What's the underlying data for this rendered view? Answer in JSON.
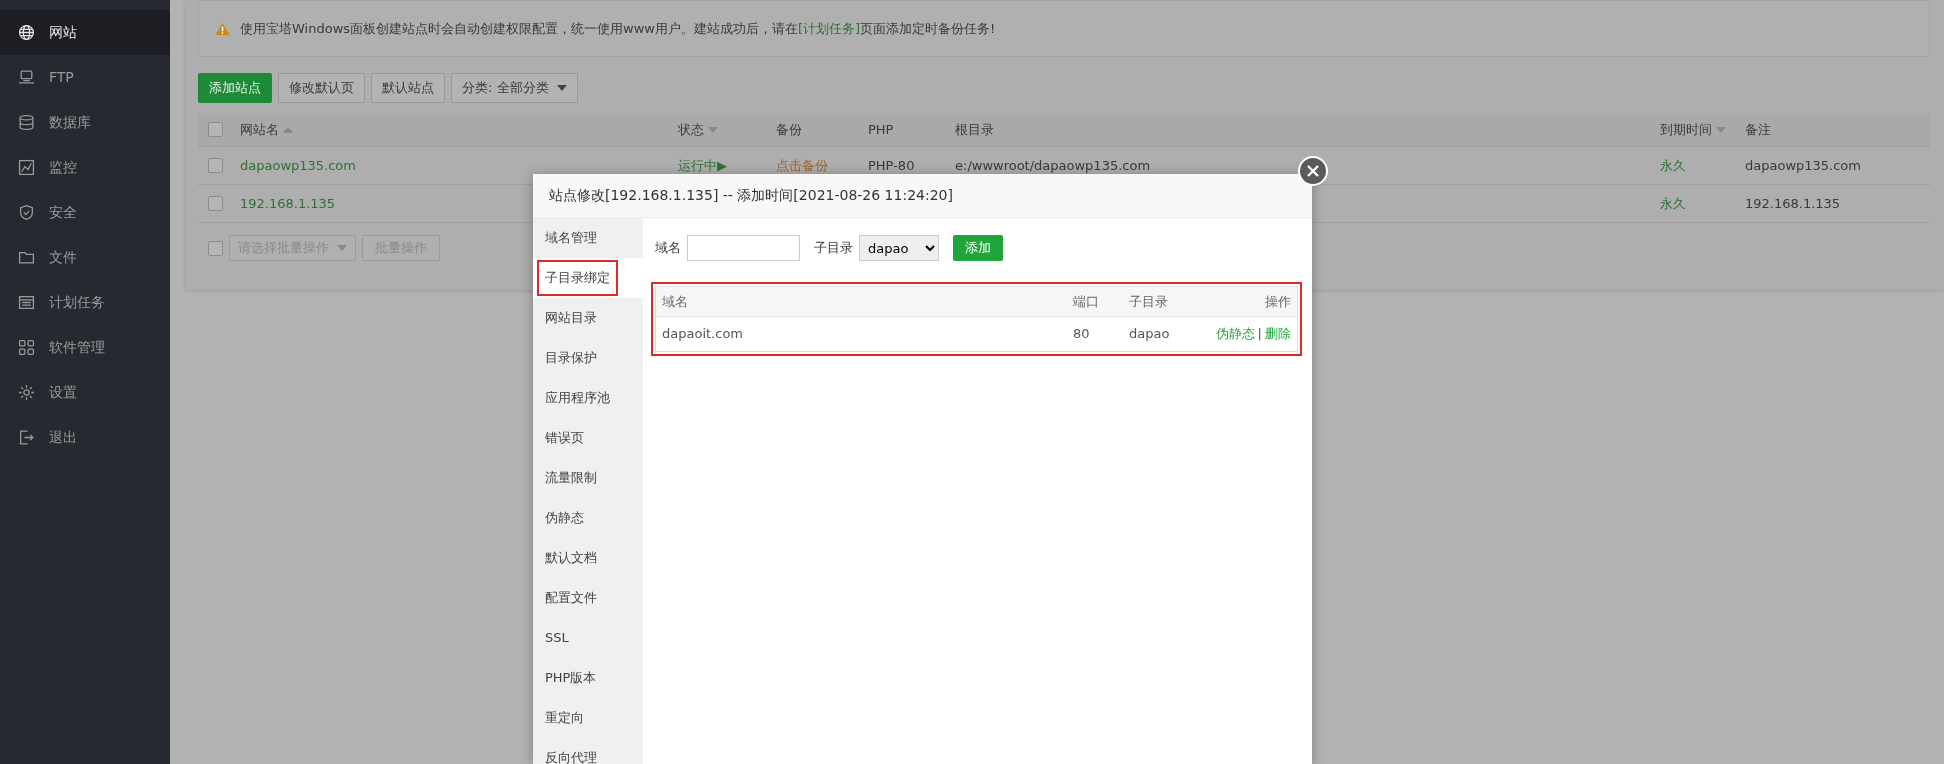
{
  "sidebar": {
    "items": [
      {
        "label": "网站",
        "selected": true
      },
      {
        "label": "FTP",
        "selected": false
      },
      {
        "label": "数据库",
        "selected": false
      },
      {
        "label": "监控",
        "selected": false
      },
      {
        "label": "安全",
        "selected": false
      },
      {
        "label": "文件",
        "selected": false
      },
      {
        "label": "计划任务",
        "selected": false
      },
      {
        "label": "软件管理",
        "selected": false
      },
      {
        "label": "设置",
        "selected": false
      },
      {
        "label": "退出",
        "selected": false
      }
    ]
  },
  "notice": {
    "before": "使用宝塔Windows面板创建站点时会自动创建权限配置，统一使用www用户。建站成功后，请在",
    "link": "[计划任务]",
    "after": "页面添加定时备份任务!"
  },
  "toolbar": [
    {
      "label": "添加站点",
      "kind": "primary"
    },
    {
      "label": "修改默认页",
      "kind": "default"
    },
    {
      "label": "默认站点",
      "kind": "default"
    },
    {
      "label": "分类: 全部分类",
      "kind": "dropdown"
    }
  ],
  "sites_table": {
    "all_checked": false,
    "columns": [
      {
        "label": "网站名",
        "sort_up": true,
        "sort_down": false
      },
      {
        "label": "状态",
        "sort_up": false,
        "sort_down": true
      },
      {
        "label": "备份",
        "sort_up": false,
        "sort_down": false
      },
      {
        "label": "PHP",
        "sort_up": false,
        "sort_down": false
      },
      {
        "label": "根目录",
        "sort_up": false,
        "sort_down": false
      },
      {
        "label": "到期时间",
        "sort_up": false,
        "sort_down": true
      },
      {
        "label": "备注",
        "sort_up": false,
        "sort_down": false
      }
    ],
    "rows": [
      {
        "checked": false,
        "name": "dapaowp135.com",
        "status": "运行中▶",
        "backup": "点击备份",
        "php": "PHP-80",
        "root": "e:/wwwroot/dapaowp135.com",
        "expiry": "永久",
        "note": "dapaowp135.com"
      },
      {
        "checked": false,
        "name": "192.168.1.135",
        "expiry": "永久",
        "note": "192.168.1.135"
      }
    ]
  },
  "batch": {
    "checked": false,
    "select_placeholder": "请选择批量操作",
    "button": "批量操作",
    "disabled": true
  },
  "modal": {
    "title": "站点修改[192.168.1.135] -- 添加时间[2021-08-26 11:24:20]",
    "menu": [
      {
        "label": "域名管理",
        "selected": false,
        "highlighted": false
      },
      {
        "label": "子目录绑定",
        "selected": true,
        "highlighted": true
      },
      {
        "label": "网站目录",
        "selected": false,
        "highlighted": false
      },
      {
        "label": "目录保护",
        "selected": false,
        "highlighted": false
      },
      {
        "label": "应用程序池",
        "selected": false,
        "highlighted": false
      },
      {
        "label": "错误页",
        "selected": false,
        "highlighted": false
      },
      {
        "label": "流量限制",
        "selected": false,
        "highlighted": false
      },
      {
        "label": "伪静态",
        "selected": false,
        "highlighted": false
      },
      {
        "label": "默认文档",
        "selected": false,
        "highlighted": false
      },
      {
        "label": "配置文件",
        "selected": false,
        "highlighted": false
      },
      {
        "label": "SSL",
        "selected": false,
        "highlighted": false
      },
      {
        "label": "PHP版本",
        "selected": false,
        "highlighted": false
      },
      {
        "label": "重定向",
        "selected": false,
        "highlighted": false
      },
      {
        "label": "反向代理",
        "selected": false,
        "highlighted": false
      }
    ],
    "form": {
      "domain_label": "域名",
      "subdir_label": "子目录",
      "subdir_value": "dapao",
      "add_button": "添加"
    },
    "table": {
      "highlighted": true,
      "columns": [
        "域名",
        "端口",
        "子目录",
        "操作"
      ],
      "rows": [
        {
          "domain": "dapaoit.com",
          "port": "80",
          "subdir": "dapao",
          "actions": [
            "伪静态",
            "删除"
          ],
          "separator": "|"
        }
      ]
    }
  }
}
